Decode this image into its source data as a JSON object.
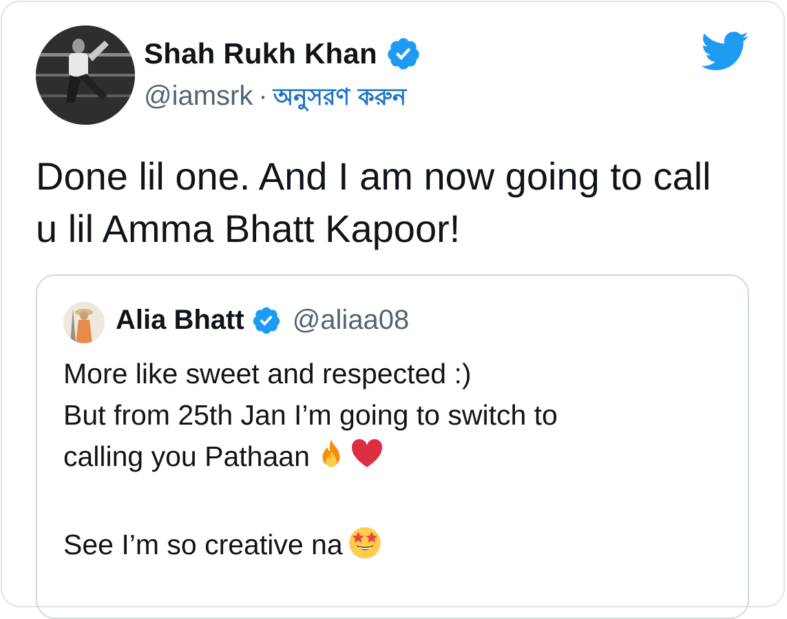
{
  "tweet": {
    "author_name": "Shah Rukh Khan",
    "author_handle": "@iamsrk",
    "separator": "·",
    "follow_label": "অনুসরণ করুন",
    "text_line1": "Done lil one. And I am now going to call",
    "text_line2": "u lil Amma Bhatt Kapoor!"
  },
  "quoted": {
    "author_name": "Alia Bhatt",
    "author_handle": "@aliaa08",
    "line1": "More like sweet and respected :)",
    "line2": "But from 25th Jan I’m going to switch to",
    "line3": "calling you Pathaan",
    "line4": "See I’m so creative na"
  },
  "icons": {
    "verified": "verified-badge-icon",
    "twitter": "twitter-bird-icon",
    "fire": "fire-emoji",
    "heart": "red-heart-emoji",
    "star_eyes": "star-struck-emoji"
  },
  "colors": {
    "verified_blue": "#1d9bf0",
    "follow_link": "#1d74c4",
    "secondary_text": "#536471",
    "border": "#cfd9de"
  }
}
